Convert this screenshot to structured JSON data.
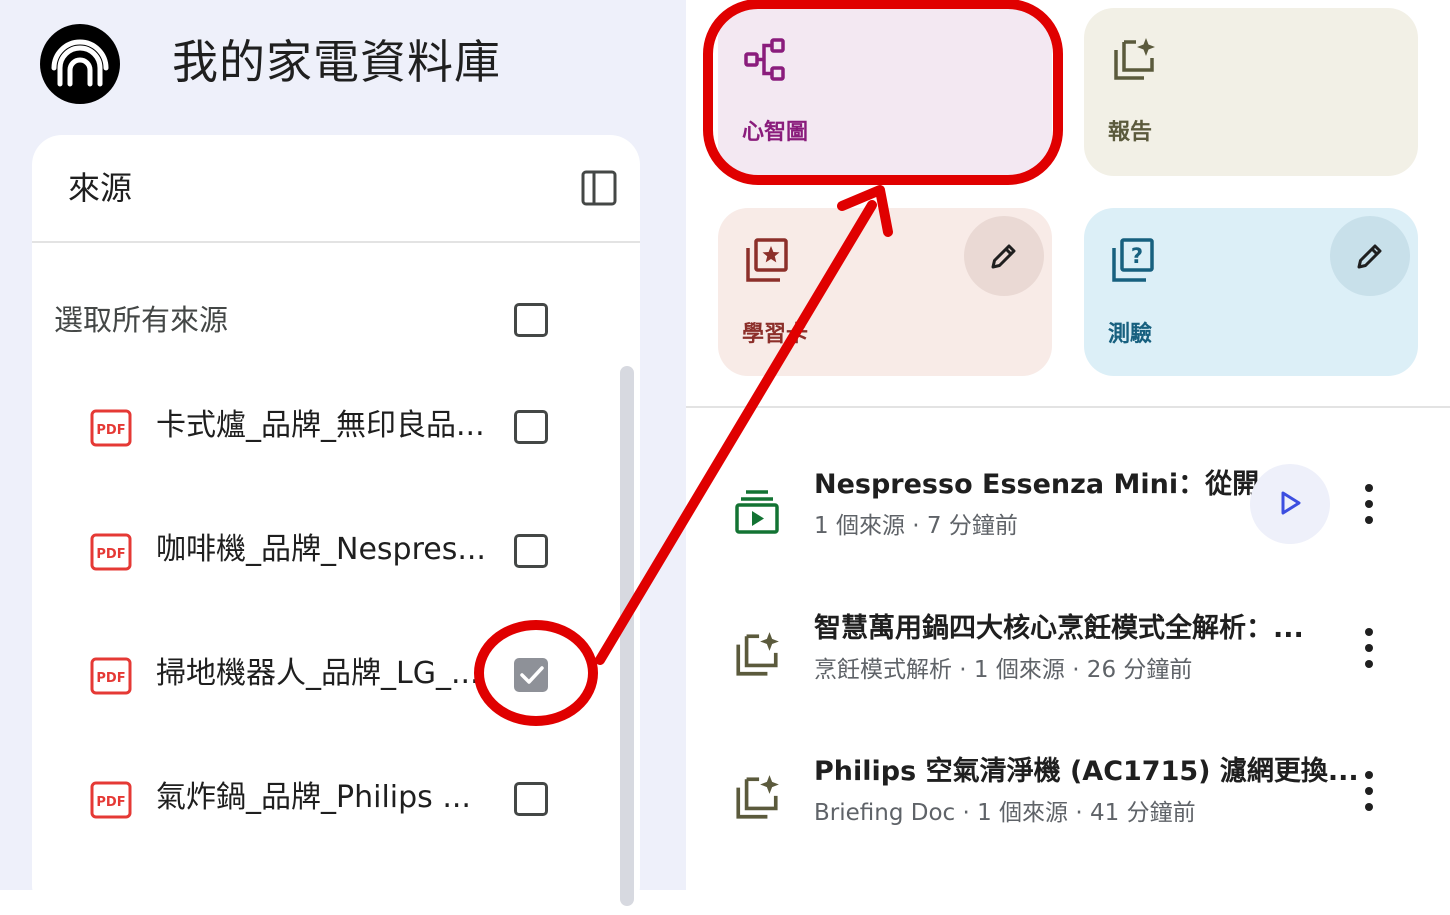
{
  "app": {
    "title": "我的家電資料庫"
  },
  "sources_panel": {
    "title": "來源",
    "select_all_label": "選取所有來源",
    "items": [
      {
        "type": "PDF",
        "name": "卡式爐_品牌_無印良品...",
        "checked": false
      },
      {
        "type": "PDF",
        "name": "咖啡機_品牌_Nespres...",
        "checked": false
      },
      {
        "type": "PDF",
        "name": "掃地機器人_品牌_LG_...",
        "checked": true
      },
      {
        "type": "PDF",
        "name": "氣炸鍋_品牌_Philips ...",
        "checked": false
      }
    ]
  },
  "studio": {
    "tiles": [
      {
        "label": "心智圖",
        "icon": "mind-map-icon",
        "bg": "#f3e8f2",
        "fg": "#8a1c7c",
        "highlighted": true
      },
      {
        "label": "報告",
        "icon": "report-sparkle-icon",
        "bg": "#f2f0e6",
        "fg": "#5b5a3c",
        "highlighted": false
      },
      {
        "label": "學習卡",
        "icon": "flashcards-icon",
        "bg": "#f8ebe7",
        "fg": "#8c2f2a",
        "highlighted": false
      },
      {
        "label": "測驗",
        "icon": "quiz-icon",
        "bg": "#dceff7",
        "fg": "#17607f",
        "highlighted": false
      }
    ],
    "notes": [
      {
        "title": "Nespresso Essenza Mini：從開...",
        "meta": "1 個來源 · 7 分鐘前",
        "icon": "audio-overview-icon",
        "has_play": true
      },
      {
        "title": "智慧萬用鍋四大核心烹飪模式全解析：...",
        "meta": "烹飪模式解析 · 1 個來源 · 26 分鐘前",
        "icon": "report-sparkle-icon",
        "has_play": false
      },
      {
        "title": "Philips 空氣清淨機 (AC1715) 濾網更換...",
        "meta": "Briefing Doc · 1 個來源 · 41 分鐘前",
        "icon": "report-sparkle-icon",
        "has_play": false
      }
    ]
  },
  "colors": {
    "annotation": "#e00000",
    "left_bg": "#eef0fa",
    "accent": "#3c4ee0"
  }
}
